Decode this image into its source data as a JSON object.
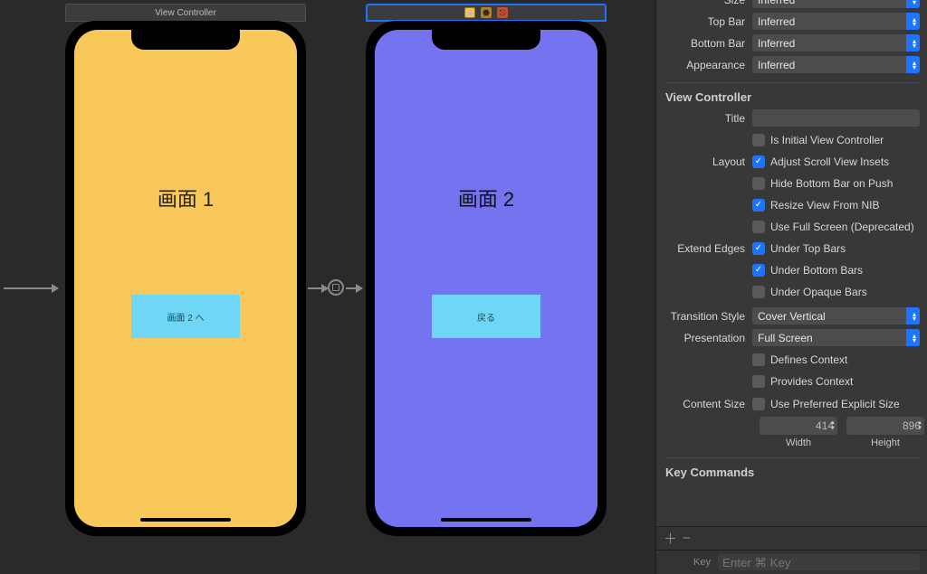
{
  "canvas": {
    "scene1": {
      "bar_title": "View Controller",
      "screen_label": "画面 1",
      "button_label": "画面 2 へ",
      "bg": "#f8c95a"
    },
    "scene2": {
      "screen_label": "画面 2",
      "button_label": "戻る",
      "bg": "#7673f0"
    }
  },
  "inspector": {
    "simulated": {
      "size": {
        "label": "Size",
        "value": "Inferred"
      },
      "top_bar": {
        "label": "Top Bar",
        "value": "Inferred"
      },
      "bottom_bar": {
        "label": "Bottom Bar",
        "value": "Inferred"
      },
      "appearance": {
        "label": "Appearance",
        "value": "Inferred"
      }
    },
    "vc_section": "View Controller",
    "title": {
      "label": "Title",
      "value": ""
    },
    "is_initial": {
      "label": "Is Initial View Controller",
      "checked": false
    },
    "layout": {
      "label": "Layout",
      "adjust": {
        "label": "Adjust Scroll View Insets",
        "checked": true
      },
      "hide_bottom": {
        "label": "Hide Bottom Bar on Push",
        "checked": false
      },
      "resize_nib": {
        "label": "Resize View From NIB",
        "checked": true
      },
      "full_screen": {
        "label": "Use Full Screen (Deprecated)",
        "checked": false
      }
    },
    "extend": {
      "label": "Extend Edges",
      "top": {
        "label": "Under Top Bars",
        "checked": true
      },
      "bottom": {
        "label": "Under Bottom Bars",
        "checked": true
      },
      "opaque": {
        "label": "Under Opaque Bars",
        "checked": false
      }
    },
    "transition": {
      "label": "Transition Style",
      "value": "Cover Vertical"
    },
    "presentation": {
      "label": "Presentation",
      "value": "Full Screen"
    },
    "defines_context": {
      "label": "Defines Context",
      "checked": false
    },
    "provides_context": {
      "label": "Provides Context",
      "checked": false
    },
    "content_size": {
      "label": "Content Size",
      "use_pref": {
        "label": "Use Preferred Explicit Size",
        "checked": false
      },
      "width": {
        "label": "Width",
        "value": "414"
      },
      "height": {
        "label": "Height",
        "value": "896"
      }
    },
    "key_commands": "Key Commands",
    "key_row": {
      "label": "Key",
      "placeholder": "Enter ⌘ Key"
    }
  }
}
